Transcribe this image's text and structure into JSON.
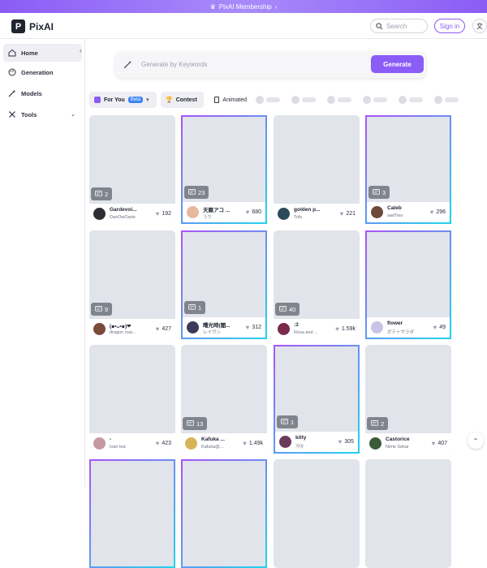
{
  "banner": {
    "text": "PixAI Membership",
    "icon": "crown-icon"
  },
  "header": {
    "brand": "PixAI",
    "logo_letter": "P",
    "search_placeholder": "Search",
    "signin_label": "Sign in",
    "lang_icon": "translate-icon"
  },
  "sidebar": {
    "items": [
      {
        "label": "Home",
        "icon": "home-icon",
        "active": true
      },
      {
        "label": "Generation",
        "icon": "palette-icon",
        "active": false
      },
      {
        "label": "Models",
        "icon": "wand-icon",
        "active": false
      },
      {
        "label": "Tools",
        "icon": "tools-icon",
        "active": false
      }
    ]
  },
  "generate": {
    "placeholder": "Generate by Keywords",
    "button_label": "Generate"
  },
  "filters": {
    "for_you": "For You",
    "beta": "Beta",
    "contest": "Contest",
    "animated": "Animated"
  },
  "cards": [
    {
      "title": "Gardevoi...",
      "author": "DaoOwOarts",
      "likes": "192",
      "comments": "2",
      "featured": false,
      "avatar_color": "#2d2d33"
    },
    {
      "title": "天籁アコ ...",
      "author": "うり",
      "likes": "680",
      "comments": "23",
      "featured": true,
      "avatar_color": "#e8b7a0"
    },
    {
      "title": "golden p...",
      "author": "Tofu",
      "likes": "221",
      "comments": "",
      "featured": false,
      "avatar_color": "#2b4a5a"
    },
    {
      "title": "Caleb",
      "author": "aadTwu",
      "likes": "296",
      "comments": "3",
      "featured": true,
      "avatar_color": "#6b4a3a"
    },
    {
      "title": "(๑•ᴗ•๑)❤",
      "author": "dragon roar...",
      "likes": "427",
      "comments": "9",
      "featured": false,
      "avatar_color": "#7a4a3a"
    },
    {
      "title": "曙光時(闇...",
      "author": "レイヴン",
      "likes": "312",
      "comments": "1",
      "featured": true,
      "avatar_color": "#3a3a5a"
    },
    {
      "title": ":3",
      "author": "Rosa and ...",
      "likes": "1.59k",
      "comments": "40",
      "featured": false,
      "avatar_color": "#7a2a4a"
    },
    {
      "title": "flower",
      "author": "ポテトサラダ",
      "likes": "49",
      "comments": "",
      "featured": true,
      "avatar_color": "#c9c3e8"
    },
    {
      "title": "-",
      "author": "Ivan tea",
      "likes": "423",
      "comments": "",
      "featured": false,
      "avatar_color": "#c49aa0"
    },
    {
      "title": "Kafuka ...",
      "author": "Kafuka@...",
      "likes": "1.49k",
      "comments": "13",
      "featured": false,
      "avatar_color": "#d8b35a"
    },
    {
      "title": "kitty",
      "author": "가아",
      "likes": "305",
      "comments": "1",
      "featured": true,
      "avatar_color": "#6b3a5a"
    },
    {
      "title": "Castorice",
      "author": "Nime Sekai",
      "likes": "407",
      "comments": "2",
      "featured": false,
      "avatar_color": "#3a5a3a"
    },
    {
      "title": "",
      "author": "",
      "likes": "",
      "comments": "",
      "featured": true,
      "avatar_color": ""
    },
    {
      "title": "",
      "author": "",
      "likes": "",
      "comments": "",
      "featured": true,
      "avatar_color": ""
    },
    {
      "title": "",
      "author": "",
      "likes": "",
      "comments": "",
      "featured": false,
      "avatar_color": ""
    },
    {
      "title": "",
      "author": "",
      "likes": "",
      "comments": "",
      "featured": false,
      "avatar_color": ""
    }
  ],
  "colors": {
    "accent": "#8b5cf6",
    "beta": "#3b82f6",
    "card_bg": "#e1e4ea"
  }
}
